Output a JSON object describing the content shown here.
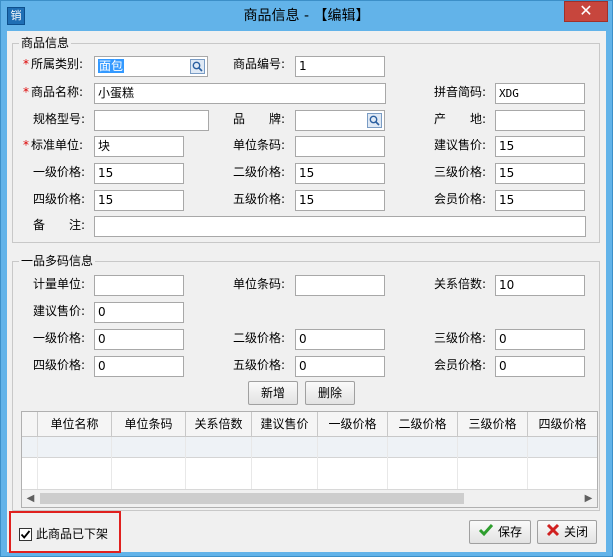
{
  "window": {
    "title": "商品信息 - 【编辑】",
    "app_icon_char": "销",
    "close_char": "✕",
    "accent": "#62b3e9"
  },
  "product_group": {
    "title": "商品信息",
    "fields": {
      "category": {
        "label": "所属类别:",
        "value": "面包",
        "required": true
      },
      "code": {
        "label": "商品编号:",
        "value": "1"
      },
      "name": {
        "label": "商品名称:",
        "value": "小蛋糕",
        "required": true
      },
      "pinyin": {
        "label": "拼音简码:",
        "value": "XDG"
      },
      "spec": {
        "label": "规格型号:",
        "value": ""
      },
      "brand": {
        "label": "品　　牌:",
        "value": ""
      },
      "origin": {
        "label": "产　　地:",
        "value": ""
      },
      "unit": {
        "label": "标准单位:",
        "value": "块",
        "required": true
      },
      "barcode": {
        "label": "单位条码:",
        "value": ""
      },
      "suggest_price": {
        "label": "建议售价:",
        "value": "15"
      },
      "price1": {
        "label": "一级价格:",
        "value": "15"
      },
      "price2": {
        "label": "二级价格:",
        "value": "15"
      },
      "price3": {
        "label": "三级价格:",
        "value": "15"
      },
      "price4": {
        "label": "四级价格:",
        "value": "15"
      },
      "price5": {
        "label": "五级价格:",
        "value": "15"
      },
      "member_price": {
        "label": "会员价格:",
        "value": "15"
      },
      "remark": {
        "label": "备　　注:",
        "value": ""
      }
    }
  },
  "multi_group": {
    "title": "一品多码信息",
    "fields": {
      "unit": {
        "label": "计量单位:",
        "value": ""
      },
      "barcode": {
        "label": "单位条码:",
        "value": ""
      },
      "ratio": {
        "label": "关系倍数:",
        "value": "10"
      },
      "suggest_price": {
        "label": "建议售价:",
        "value": "0"
      },
      "price1": {
        "label": "一级价格:",
        "value": "0"
      },
      "price2": {
        "label": "二级价格:",
        "value": "0"
      },
      "price3": {
        "label": "三级价格:",
        "value": "0"
      },
      "price4": {
        "label": "四级价格:",
        "value": "0"
      },
      "price5": {
        "label": "五级价格:",
        "value": "0"
      },
      "member_price": {
        "label": "会员价格:",
        "value": "0"
      }
    },
    "add_label": "新增",
    "delete_label": "删除",
    "table": {
      "columns": [
        "单位名称",
        "单位条码",
        "关系倍数",
        "建议售价",
        "一级价格",
        "二级价格",
        "三级价格",
        "四级价格"
      ]
    }
  },
  "footer": {
    "offshelf_label": "此商品已下架",
    "offshelf_checked": true,
    "save_label": "保存",
    "close_label": "关闭"
  }
}
